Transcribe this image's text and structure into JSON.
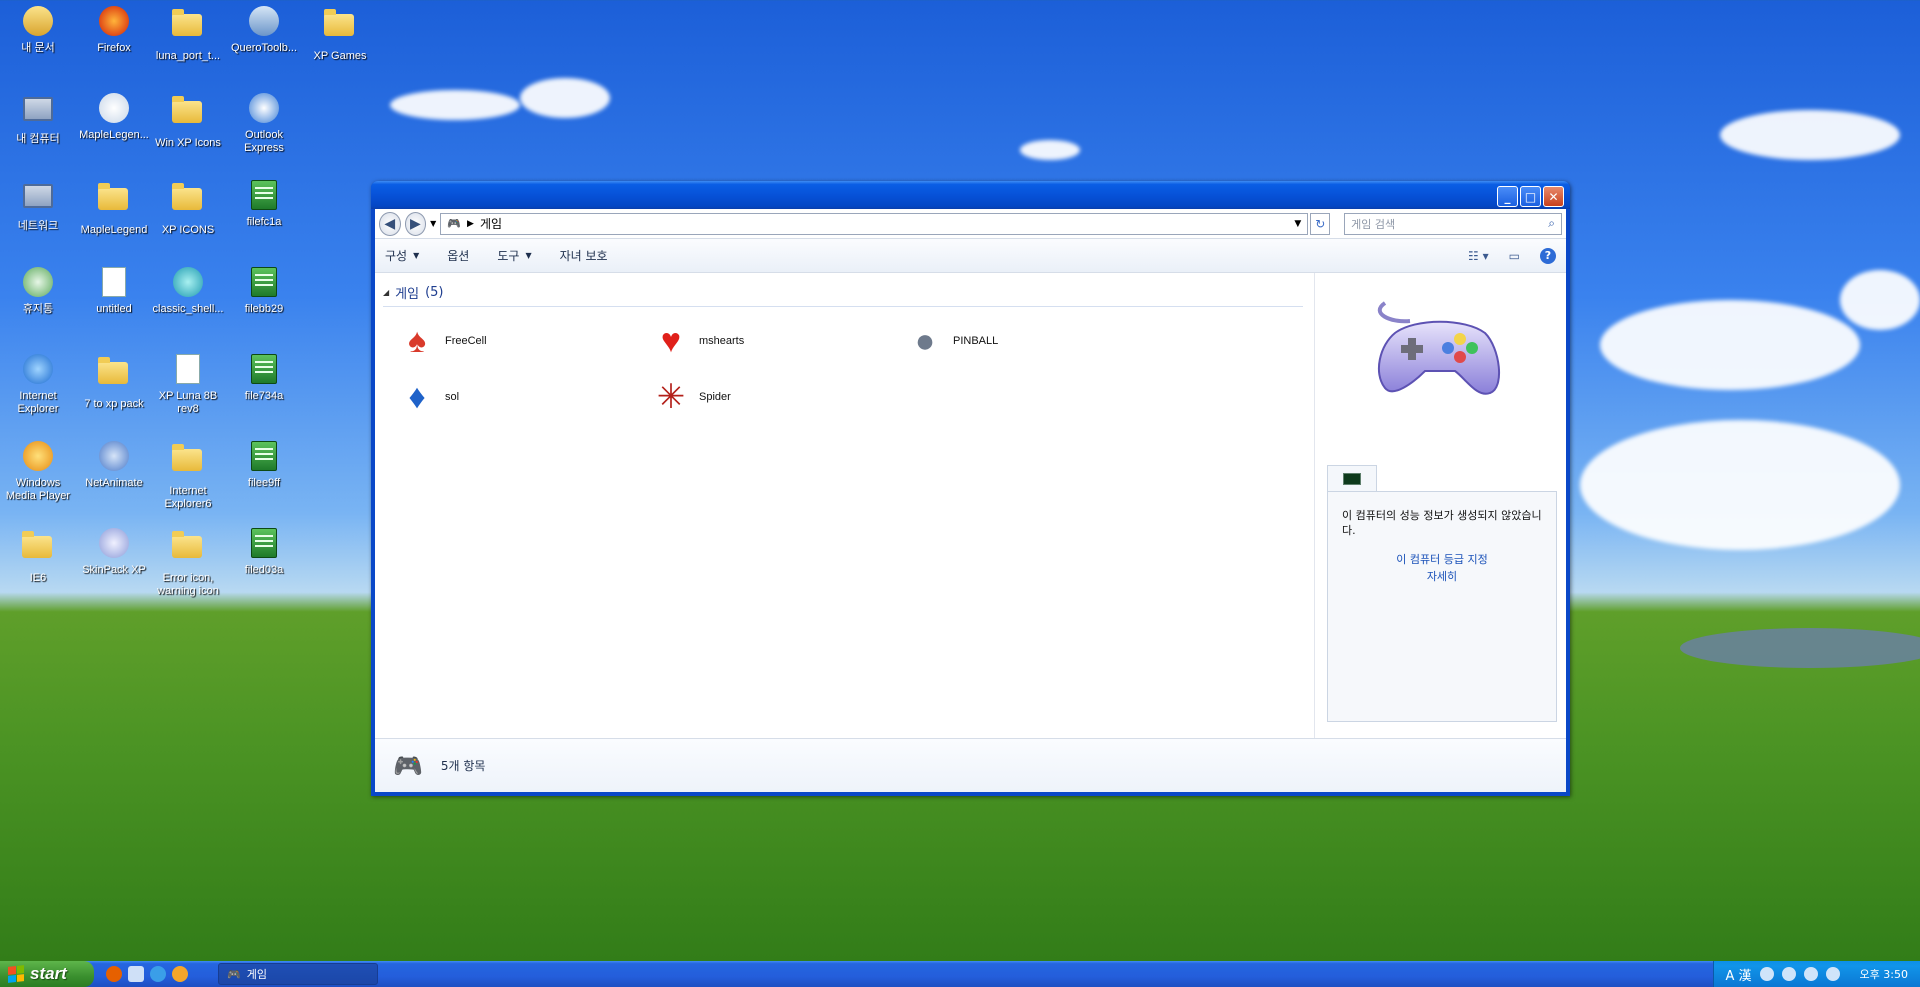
{
  "desktop": {
    "icons": [
      {
        "label": "내 문서",
        "icon": "my-documents-icon"
      },
      {
        "label": "Firefox",
        "icon": "firefox-icon"
      },
      {
        "label": "luna_port_t...",
        "icon": "folder-icon"
      },
      {
        "label": "QueroToolb...",
        "icon": "installer-icon"
      },
      {
        "label": "XP Games",
        "icon": "folder-icon"
      },
      {
        "label": "내 컴퓨터",
        "icon": "my-computer-icon"
      },
      {
        "label": "MapleLegen...",
        "icon": "snowman-icon"
      },
      {
        "label": "Win XP Icons",
        "icon": "folder-icon"
      },
      {
        "label": "Outlook Express",
        "icon": "outlook-icon"
      },
      {
        "label": "네트워크",
        "icon": "network-icon"
      },
      {
        "label": "MapleLegend",
        "icon": "folder-icon"
      },
      {
        "label": "XP ICONS",
        "icon": "folder-icon"
      },
      {
        "label": "filefc1a",
        "icon": "file-icon"
      },
      {
        "label": "휴지통",
        "icon": "recycle-bin-icon"
      },
      {
        "label": "untitled",
        "icon": "image-icon"
      },
      {
        "label": "classic_shell...",
        "icon": "shell-icon"
      },
      {
        "label": "filebb29",
        "icon": "file-icon"
      },
      {
        "label": "Internet Explorer",
        "icon": "ie-icon"
      },
      {
        "label": "7 to xp pack",
        "icon": "folder-icon"
      },
      {
        "label": "XP Luna 8B rev8",
        "icon": "document-icon"
      },
      {
        "label": "file734a",
        "icon": "file-icon"
      },
      {
        "label": "Windows Media Player",
        "icon": "media-player-icon"
      },
      {
        "label": "NetAnimate",
        "icon": "netanimate-icon"
      },
      {
        "label": "Internet Explorer6",
        "icon": "folder-icon"
      },
      {
        "label": "filee9ff",
        "icon": "file-icon"
      },
      {
        "label": "IE6",
        "icon": "folder-icon"
      },
      {
        "label": "SkinPack XP",
        "icon": "skinpack-icon"
      },
      {
        "label": "Error icon, warning icon",
        "icon": "folder-icon"
      },
      {
        "label": "filed03a",
        "icon": "file-icon"
      }
    ]
  },
  "window": {
    "address": "게임",
    "search_placeholder": "게임 검색",
    "toolbar": {
      "organize": "구성",
      "options": "옵션",
      "tools": "도구",
      "parental": "자녀 보호"
    },
    "group": {
      "title": "게임",
      "count": "(5)"
    },
    "games": [
      {
        "name": "FreeCell",
        "icon": "freecell-icon",
        "glyph": "♠"
      },
      {
        "name": "mshearts",
        "icon": "hearts-icon",
        "glyph": "♥"
      },
      {
        "name": "PINBALL",
        "icon": "pinball-icon",
        "glyph": "●"
      },
      {
        "name": "sol",
        "icon": "solitaire-icon",
        "glyph": "♦"
      },
      {
        "name": "Spider",
        "icon": "spider-icon",
        "glyph": "✳"
      }
    ],
    "perf": {
      "message": "이 컴퓨터의 성능 정보가 생성되지 않았습니다.",
      "rate_link": "이 컴퓨터 등급 지정",
      "details_link": "자세히"
    },
    "status": "5개 항목"
  },
  "taskbar": {
    "start": "start",
    "task_label": "게임",
    "tray_lang": "A 漢",
    "clock": "오후 3:50"
  }
}
